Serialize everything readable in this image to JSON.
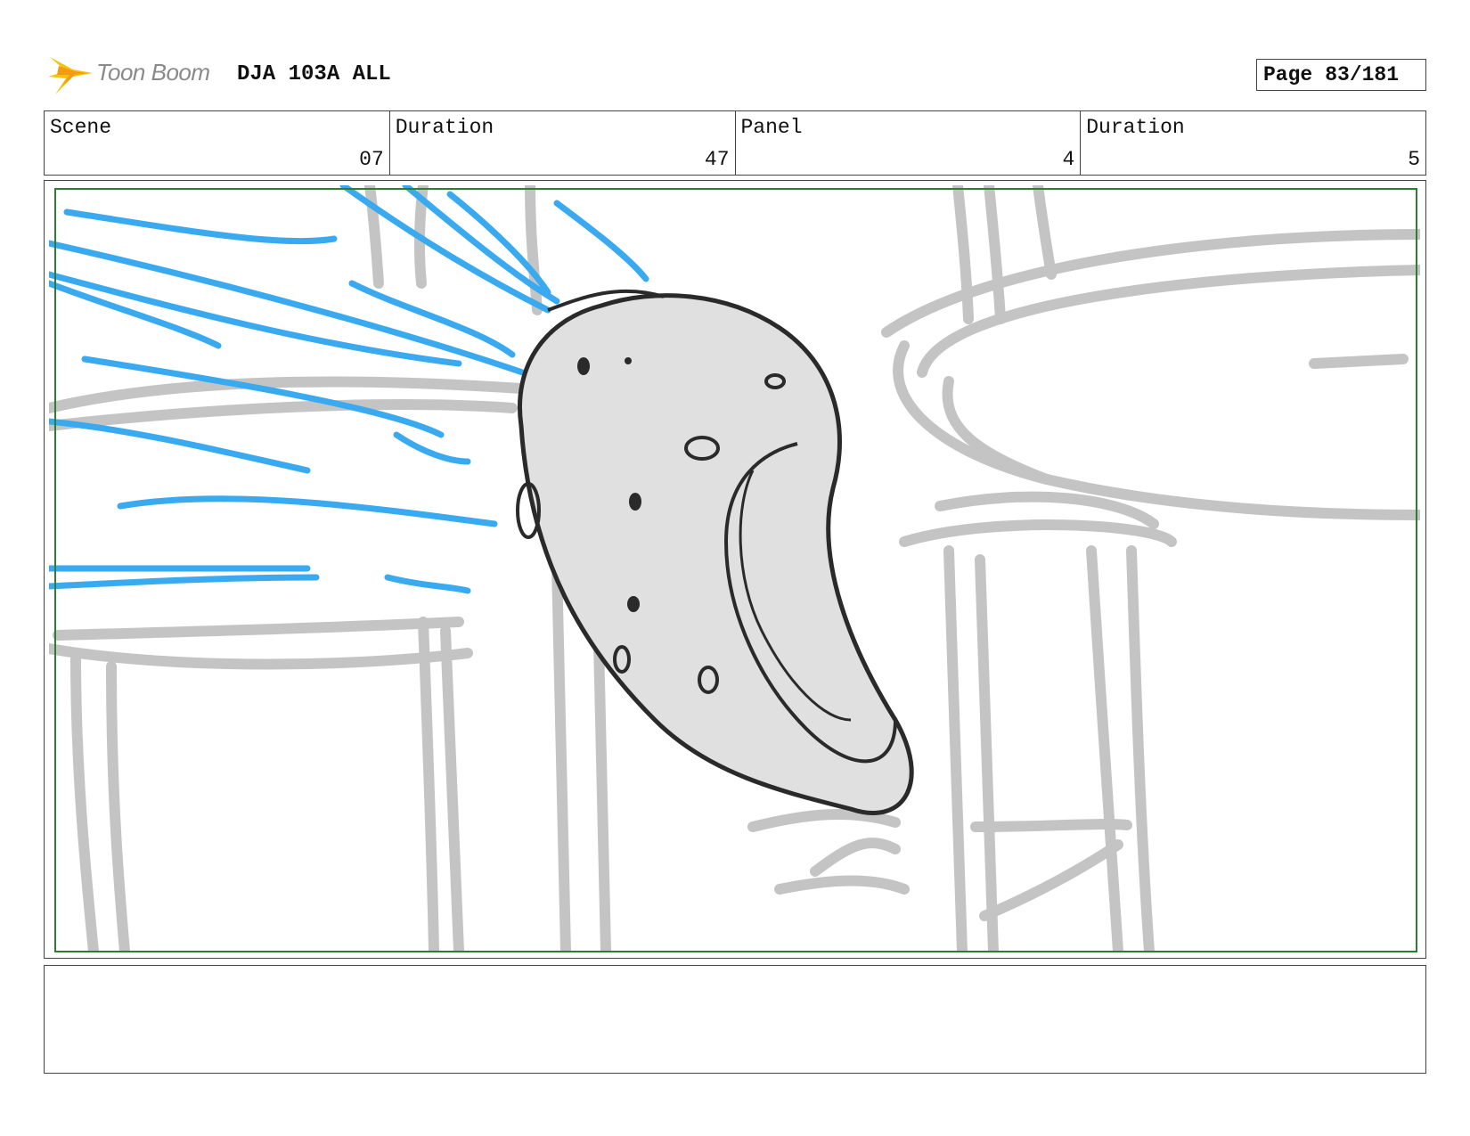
{
  "header": {
    "logo_text": "Toon Boom",
    "project_title": "DJA 103A ALL",
    "page_label": "Page",
    "page_number": "83/181"
  },
  "info": {
    "scene_label": "Scene",
    "scene_value": "07",
    "scene_duration_label": "Duration",
    "scene_duration_value": "47",
    "panel_label": "Panel",
    "panel_value": "4",
    "panel_duration_label": "Duration",
    "panel_duration_value": "5"
  },
  "notes": {
    "text": ""
  },
  "colors": {
    "frame_border": "#444444",
    "safe_area": "#2e7d32",
    "speed_lines": "#3aaaf0",
    "background_sketch": "#c4c4c4",
    "character_fill": "#e0e0e0",
    "character_outline": "#2a2a2a",
    "logo_star": "#f6c20d"
  }
}
